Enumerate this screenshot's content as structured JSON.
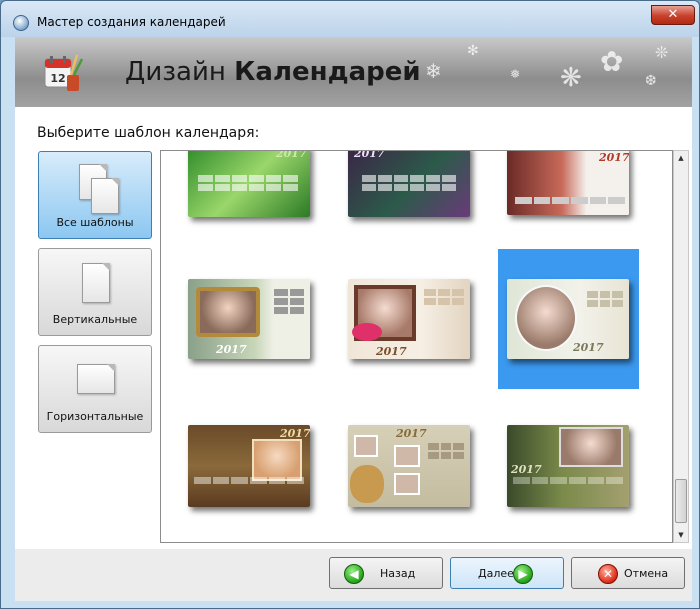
{
  "window": {
    "title": "Мастер создания календарей",
    "close_glyph": "✕",
    "accent_color": "#3b99f0"
  },
  "header": {
    "title_normal": "Дизайн ",
    "title_bold": "Календарей",
    "icon_day": "12",
    "icon": "calendar-with-brushes-icon"
  },
  "main": {
    "prompt": "Выберите шаблон календаря:"
  },
  "categories": [
    {
      "label": "Все шаблоны",
      "selected": true,
      "icon": "documents-icon"
    },
    {
      "label": "Вертикальные",
      "selected": false,
      "icon": "portrait-page-icon"
    },
    {
      "label": "Горизонтальные",
      "selected": false,
      "icon": "landscape-page-icon"
    }
  ],
  "templates": [
    {
      "year": "2017",
      "selected": false
    },
    {
      "year": "2017",
      "selected": false
    },
    {
      "year": "2017",
      "selected": false
    },
    {
      "year": "2017",
      "selected": false
    },
    {
      "year": "2017",
      "selected": false
    },
    {
      "year": "2017",
      "selected": true
    },
    {
      "year": "2017",
      "selected": false
    },
    {
      "year": "2017",
      "selected": false
    },
    {
      "year": "2017",
      "selected": false
    }
  ],
  "scrollbar": {
    "up_glyph": "▲",
    "down_glyph": "▼",
    "position_fraction": 0.95
  },
  "footer": {
    "back_label": "Назад",
    "next_label": "Далее",
    "cancel_label": "Отмена",
    "back_glyph": "◀",
    "next_glyph": "▶",
    "cancel_glyph": "✕"
  }
}
